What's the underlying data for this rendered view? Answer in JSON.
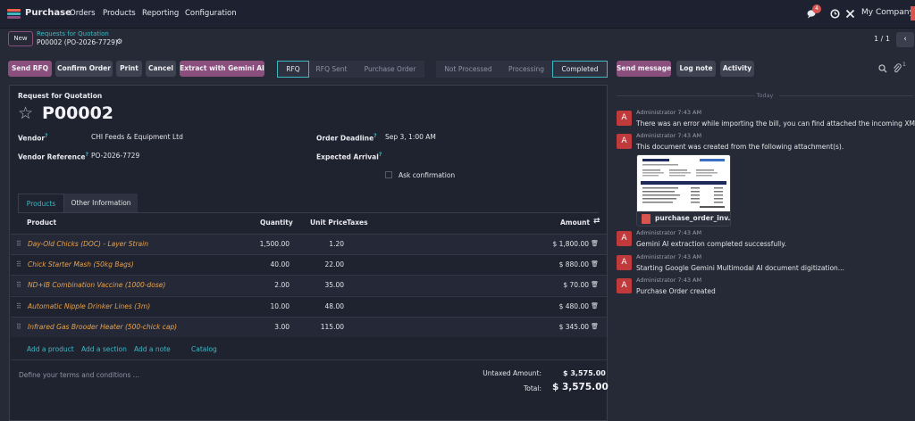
{
  "topbar": {
    "app_name": "Purchase",
    "menu": [
      "Orders",
      "Products",
      "Reporting",
      "Configuration"
    ],
    "chat_count": "4",
    "company": "My Company",
    "brand_colors": [
      "#f06050",
      "#3fb8c4",
      "#8a4f7d"
    ]
  },
  "control": {
    "new_label": "New",
    "breadcrumb_parent": "Requests for Quotation",
    "breadcrumb_current": "P00002 (PO-2026-7729)",
    "pager": "1 / 1"
  },
  "actions": [
    "Send RFQ",
    "Confirm Order",
    "Print",
    "Cancel",
    "Extract with Gemini AI"
  ],
  "status_bar": {
    "stages": [
      "RFQ",
      "RFQ Sent",
      "Purchase Order"
    ],
    "active_stage": "RFQ",
    "extraction_stages": [
      "Not Processed",
      "Processing",
      "Completed"
    ],
    "active_extraction": "Completed"
  },
  "form": {
    "type_label": "Request for Quotation",
    "name": "P00002",
    "vendor_label": "Vendor",
    "vendor": "CHI Feeds & Equipment Ltd",
    "vendor_ref_label": "Vendor Reference",
    "vendor_ref": "PO-2026-7729",
    "deadline_label": "Order Deadline",
    "deadline": "Sep 3, 1:00 AM",
    "expected_label": "Expected Arrival",
    "ask_confirmation": "Ask confirmation"
  },
  "tabs": [
    "Products",
    "Other Information"
  ],
  "table": {
    "headers": {
      "product": "Product",
      "quantity": "Quantity",
      "unit_price": "Unit Price",
      "taxes": "Taxes",
      "amount": "Amount"
    },
    "rows": [
      {
        "product": "Day-Old Chicks (DOC) - Layer Strain",
        "quantity": "1,500.00",
        "price": "1.20",
        "amount": "$ 1,800.00"
      },
      {
        "product": "Chick Starter Mash (50kg Bags)",
        "quantity": "40.00",
        "price": "22.00",
        "amount": "$ 880.00"
      },
      {
        "product": "ND+IB Combination Vaccine (1000-dose)",
        "quantity": "2.00",
        "price": "35.00",
        "amount": "$ 70.00"
      },
      {
        "product": "Automatic Nipple Drinker Lines (3m)",
        "quantity": "10.00",
        "price": "48.00",
        "amount": "$ 480.00"
      },
      {
        "product": "Infrared Gas Brooder Heater (500-chick cap)",
        "quantity": "3.00",
        "price": "115.00",
        "amount": "$ 345.00"
      }
    ],
    "add_links": [
      "Add a product",
      "Add a section",
      "Add a note",
      "Catalog"
    ]
  },
  "footer": {
    "terms_placeholder": "Define your terms and conditions ...",
    "untaxed_label": "Untaxed Amount:",
    "untaxed": "$ 3,575.00",
    "total_label": "Total:",
    "total": "$ 3,575.00"
  },
  "chatter": {
    "buttons": [
      "Send message",
      "Log note",
      "Activity"
    ],
    "attachment_count": "1",
    "today_label": "Today",
    "messages": [
      {
        "author": "Administrator",
        "time": "7:43 AM",
        "body": "There was an error while importing the bill, you can find attached the incoming XML."
      },
      {
        "author": "Administrator",
        "time": "7:43 AM",
        "body": "This document was created from the following attachment(s)."
      },
      {
        "author": "Administrator",
        "time": "7:43 AM",
        "body": "Gemini AI extraction completed successfully."
      },
      {
        "author": "Administrator",
        "time": "7:43 AM",
        "body": "Starting Google Gemini Multimodal AI document digitization..."
      },
      {
        "author": "Administrator",
        "time": "7:43 AM",
        "body": "Purchase Order created"
      }
    ],
    "attachment_name": "purchase_order_inv...",
    "avatar_initial": "A"
  }
}
